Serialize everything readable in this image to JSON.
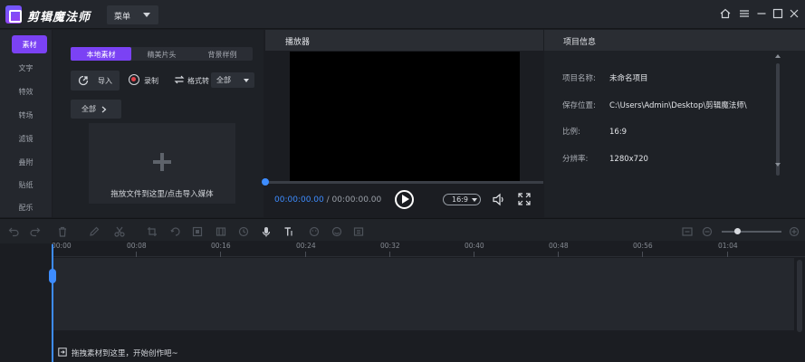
{
  "app": {
    "title": "剪辑魔法师",
    "menu_label": "菜单"
  },
  "rail": {
    "items": [
      "素材",
      "文字",
      "特效",
      "转场",
      "滤镜",
      "叠附",
      "贴纸",
      "配乐"
    ]
  },
  "media": {
    "tabs": [
      "本地素材",
      "精美片头",
      "背景样例"
    ],
    "import_label": "导入",
    "record_label": "录制",
    "convert_label": "格式转",
    "filter_selected": "全部",
    "all_label": "全部",
    "drop_hint": "拖放文件到这里/点击导入媒体"
  },
  "player": {
    "title": "播放器",
    "current_time": "00:00:00.00",
    "separator": " / ",
    "total_time": "00:00:00.00",
    "ratio": "16:9"
  },
  "project": {
    "title": "项目信息",
    "rows": [
      {
        "key": "项目名称:",
        "value": "未命名项目"
      },
      {
        "key": "保存位置:",
        "value": "C:\\Users\\Admin\\Desktop\\剪辑魔法师\\"
      },
      {
        "key": "比例:",
        "value": "16:9"
      },
      {
        "key": "分辨率:",
        "value": "1280x720"
      }
    ]
  },
  "timeline": {
    "ticks": [
      "00:00",
      "00:08",
      "00:16",
      "00:24",
      "00:32",
      "00:40",
      "00:48",
      "00:56",
      "01:04"
    ],
    "drop_hint": "拖拽素材到这里，开始创作吧~"
  },
  "colors": {
    "accent": "#7b42f4",
    "playhead": "#3d8cff"
  }
}
